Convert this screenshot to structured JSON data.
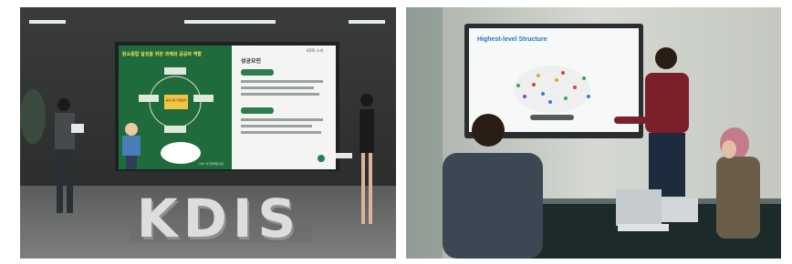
{
  "left_photo": {
    "slide": {
      "title": "탄소중립 달성을 위한 과제와 공공의 역할",
      "tag": "KDIS 소개",
      "side_heading": "성공요인",
      "center_label": "공공기관 지원센터",
      "footer_note": "출처: 국가정책연구원"
    },
    "logo": "KDIS"
  },
  "right_photo": {
    "screen_title": "Highest-level Structure"
  }
}
